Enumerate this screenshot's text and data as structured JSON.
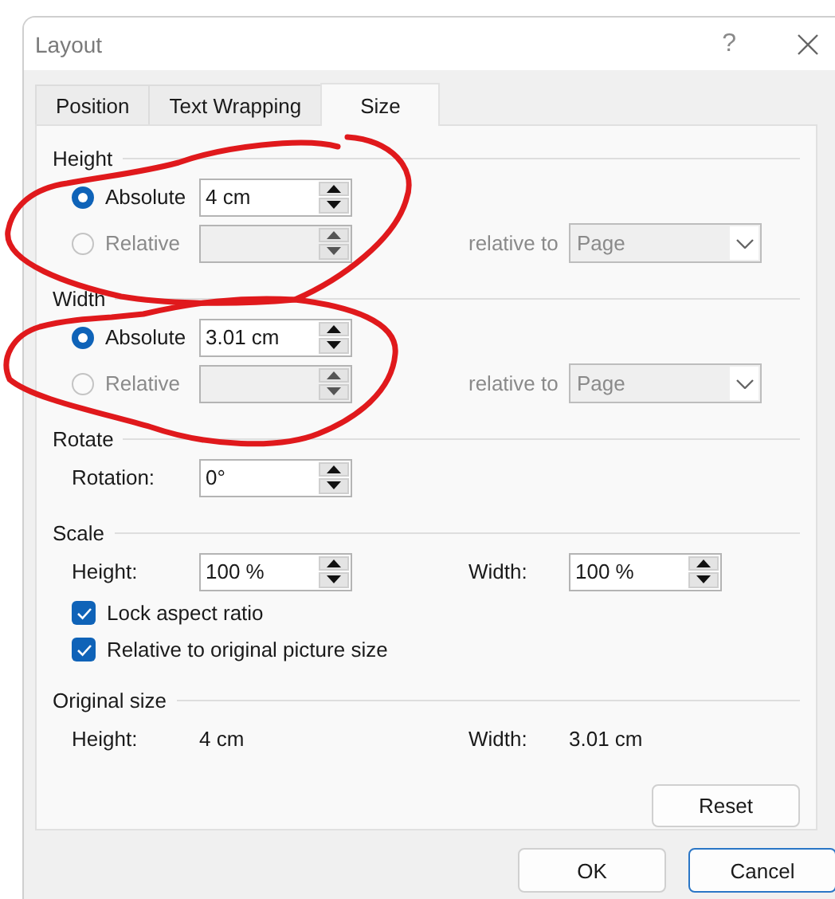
{
  "window": {
    "title": "Layout",
    "help": "?"
  },
  "tabs": [
    {
      "label": "Position",
      "selected": false
    },
    {
      "label": "Text Wrapping",
      "selected": false
    },
    {
      "label": "Size",
      "selected": true
    }
  ],
  "sections": [
    {
      "title": "Height",
      "rows": [
        {
          "kind": "radio",
          "label": "Absolute",
          "selected": true,
          "disabled": false,
          "value": "4 cm"
        },
        {
          "kind": "radio",
          "label": "Relative",
          "selected": false,
          "disabled": true,
          "relative_label": "relative to",
          "relative_value": "Page"
        }
      ]
    },
    {
      "title": "Width",
      "rows": [
        {
          "kind": "radio",
          "label": "Absolute",
          "selected": true,
          "disabled": false,
          "value": "3.01 cm"
        },
        {
          "kind": "radio",
          "label": "Relative",
          "selected": false,
          "disabled": true,
          "relative_label": "relative to",
          "relative_value": "Page"
        }
      ]
    },
    {
      "title": "Rotate",
      "rows": [
        {
          "kind": "spin",
          "label": "Rotation:",
          "value": "0°"
        }
      ]
    },
    {
      "title": "Scale",
      "rows": [
        {
          "kind": "spin-pair",
          "label": "Height:",
          "value": "100 %",
          "label2": "Width:",
          "value2": "100 %"
        },
        {
          "kind": "checkbox",
          "label": "Lock aspect ratio",
          "checked": true
        },
        {
          "kind": "checkbox",
          "label": "Relative to original picture size",
          "checked": true
        }
      ]
    },
    {
      "title": "Original size",
      "rows": [
        {
          "kind": "info-pair",
          "label": "Height:",
          "value": "4 cm",
          "label2": "Width:",
          "value2": "3.01 cm"
        }
      ]
    }
  ],
  "panel_buttons": [
    "Reset"
  ],
  "buttons": [
    {
      "label": "OK",
      "focused": false
    },
    {
      "label": "Cancel",
      "focused": true
    }
  ],
  "annotations": [
    {
      "kind": "freehand-loop"
    },
    {
      "kind": "freehand-loop"
    }
  ]
}
